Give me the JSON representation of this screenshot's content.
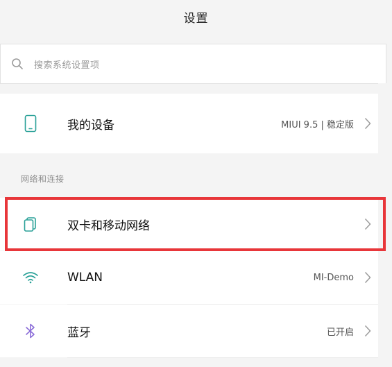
{
  "header": {
    "title": "设置"
  },
  "search": {
    "placeholder": "搜索系统设置项",
    "icon": "search-icon"
  },
  "device": {
    "label": "我的设备",
    "value": "MIUI 9.5 | 稳定版",
    "icon": "phone-icon"
  },
  "section": {
    "label": "网络和连接"
  },
  "items": [
    {
      "label": "双卡和移动网络",
      "value": "",
      "icon": "sim-cards-icon"
    },
    {
      "label": "WLAN",
      "value": "MI-Demo",
      "icon": "wifi-icon"
    },
    {
      "label": "蓝牙",
      "value": "已开启",
      "icon": "bluetooth-icon"
    }
  ],
  "colors": {
    "accent": "#2aa198",
    "highlight": "#e8363a",
    "bluetooth": "#8a6cd8"
  }
}
